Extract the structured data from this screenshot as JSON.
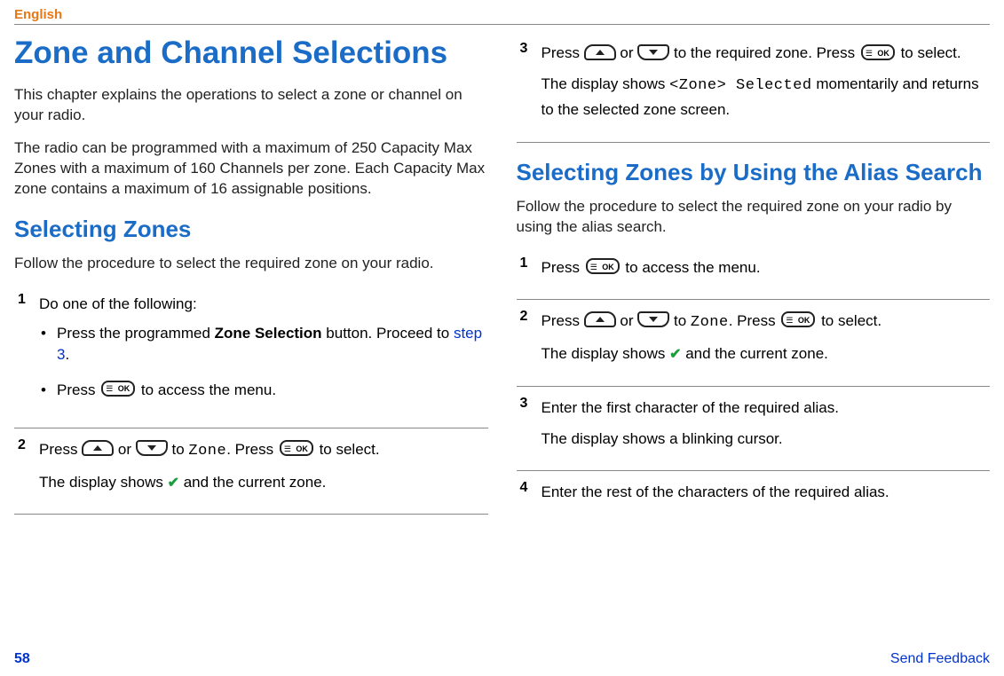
{
  "header": {
    "language": "English"
  },
  "left": {
    "title": "Zone and Channel Selections",
    "intro1": "This chapter explains the operations to select a zone or channel on your radio.",
    "intro2": "The radio can be programmed with a maximum of 250 Capacity Max Zones with a maximum of 160 Channels per zone. Each Capacity Max zone contains a maximum of 16 assignable positions.",
    "section1": {
      "title": "Selecting Zones",
      "intro": "Follow the procedure to select the required zone on your radio.",
      "step1": {
        "num": "1",
        "lead": "Do one of the following:",
        "bullet1a": "Press the programmed ",
        "bullet1bold": "Zone Selection",
        "bullet1b": " button. Proceed to ",
        "bullet1link": "step 3",
        "bullet1c": ".",
        "bullet2a": "Press ",
        "bullet2b": " to access the menu."
      },
      "step2": {
        "num": "2",
        "line1a": "Press ",
        "line1b": " or ",
        "line1c": " to ",
        "line1mono": "Zone",
        "line1d": ". Press ",
        "line1e": " to select.",
        "line2a": "The display shows ",
        "line2b": " and the current zone."
      }
    }
  },
  "right": {
    "step3": {
      "num": "3",
      "line1a": "Press ",
      "line1b": " or ",
      "line1c": " to the required zone. Press ",
      "line1d": " to select.",
      "line2a": "The display shows ",
      "line2mono": "<Zone> Selected",
      "line2b": " momentarily and returns to the selected zone screen."
    },
    "section2": {
      "title": "Selecting Zones by Using the Alias Search",
      "intro": "Follow the procedure to select the required zone on your radio by using the alias search.",
      "step1": {
        "num": "1",
        "a": "Press ",
        "b": " to access the menu."
      },
      "step2": {
        "num": "2",
        "l1a": "Press ",
        "l1b": " or ",
        "l1c": " to ",
        "l1mono": "Zone",
        "l1d": ". Press ",
        "l1e": " to select.",
        "l2a": "The display shows ",
        "l2b": " and the current zone."
      },
      "step3": {
        "num": "3",
        "l1": "Enter the first character of the required alias.",
        "l2": "The display shows a blinking cursor."
      },
      "step4": {
        "num": "4",
        "l1": "Enter the rest of the characters of the required alias."
      }
    }
  },
  "footer": {
    "page": "58",
    "feedback": "Send Feedback"
  }
}
